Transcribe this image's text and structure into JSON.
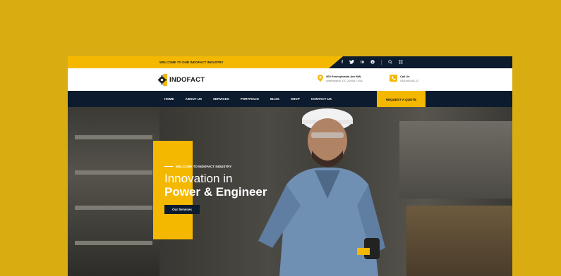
{
  "topbar": {
    "welcome": "WELCOME TO OUR INDOFACT INDUSTRY",
    "social": [
      "f",
      "t",
      "in",
      "p"
    ],
    "search_icon": "search-icon",
    "menu_icon": "grid-icon"
  },
  "header": {
    "brand": "INDOFACT",
    "address_line1": "300 Pennsylvania Ave NW,",
    "address_line2": "Washington, DC 20006, USA",
    "call_label": "Call Us",
    "phone": "938-985-66-22"
  },
  "nav": {
    "items": [
      "HOME",
      "ABOUT US",
      "SERVICES",
      "PORTFOLIO",
      "BLOG",
      "SHOP",
      "CONTACT US"
    ],
    "quote": "REQUEST A QUOTE"
  },
  "hero": {
    "tagline": "WELCOME TO INDOFACT INDUSTRY",
    "title_line1": "Innovation in",
    "title_line2": "Power & Engineer",
    "button": "Our Services"
  },
  "colors": {
    "accent": "#f5b800",
    "dark": "#0d1b2e",
    "backdrop": "#d9ac12"
  }
}
